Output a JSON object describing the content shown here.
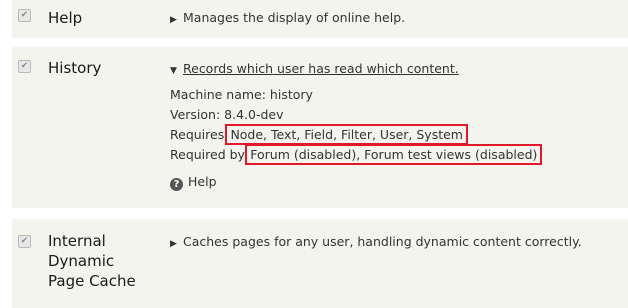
{
  "modules": [
    {
      "name": "Help",
      "description": "Manages the display of online help.",
      "enabled": true
    },
    {
      "name": "History",
      "description": "Records which user has read which content.",
      "enabled": true,
      "details": {
        "machine_name": "Machine name: history",
        "version": "Version: 8.4.0-dev",
        "requires_label": "Requires:",
        "requires_value": "Node, Text, Field, Filter, User, System",
        "required_by_label": "Required by:",
        "required_by_value": "Forum (disabled), Forum test views (disabled)",
        "help_link": "Help"
      }
    },
    {
      "name_lines": [
        "Internal",
        "Dynamic",
        "Page Cache"
      ],
      "description": "Caches pages for any user, handling dynamic content correctly.",
      "enabled": true
    }
  ],
  "colors": {
    "row_background": "#f3f4ee",
    "highlight_box": "#e3172b"
  },
  "icons": {
    "checkbox": "checkmark",
    "expander": "triangle-right",
    "expanded": "triangle-down",
    "help": "question-circle"
  }
}
